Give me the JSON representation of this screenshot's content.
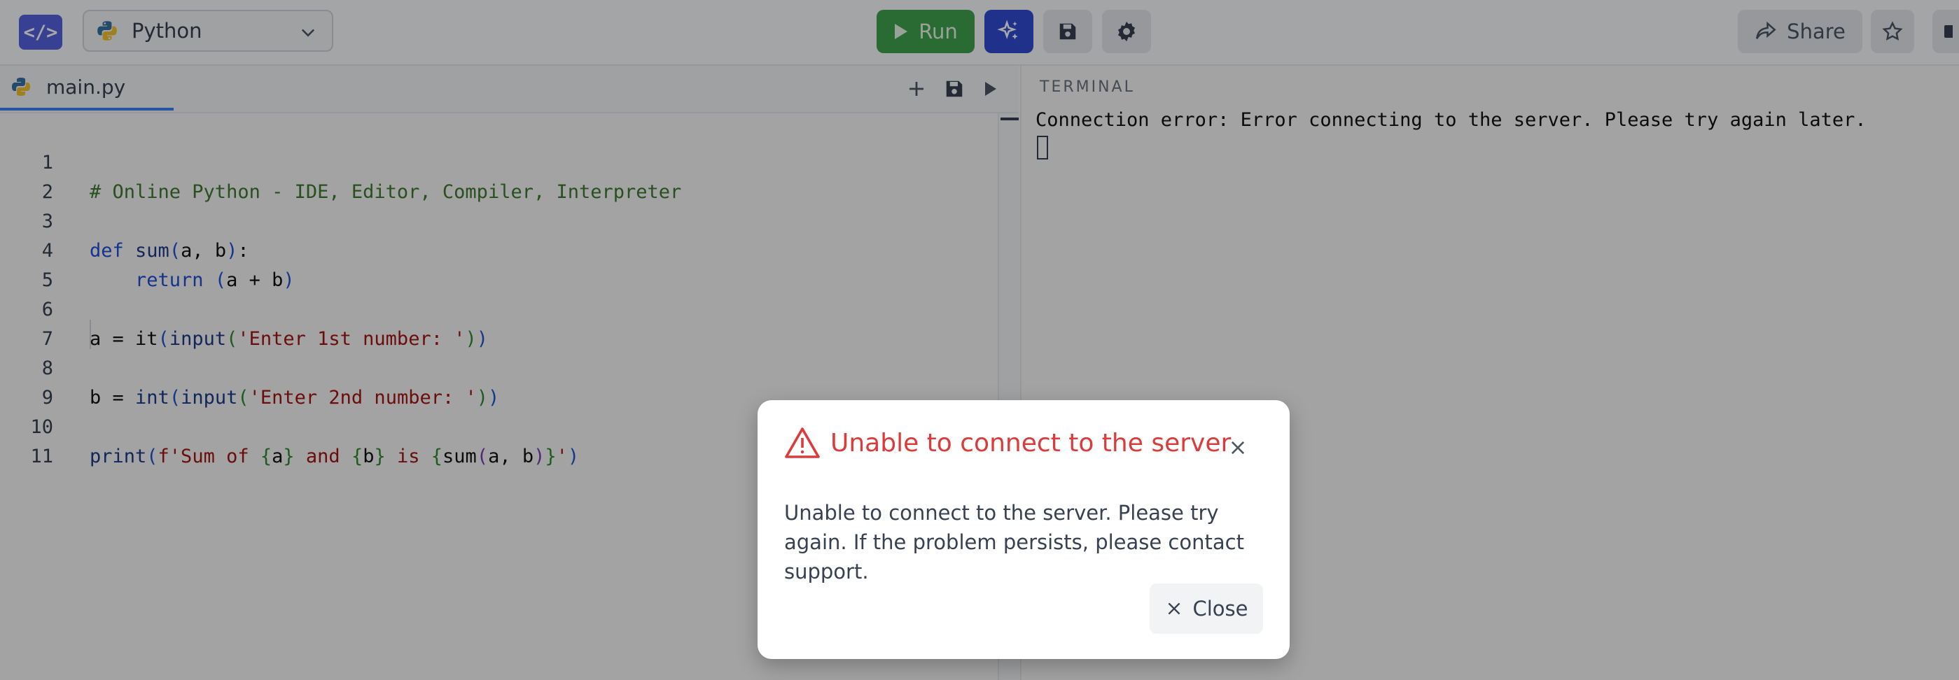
{
  "app": {
    "logo_text": "</>",
    "language": "Python",
    "accent_color": "#2f4bd3",
    "run_color": "#3fa34d"
  },
  "toolbar": {
    "run_label": "Run",
    "share_label": "Share",
    "icons": [
      "play-icon",
      "sparkles-icon",
      "save-icon",
      "gear-icon",
      "share-icon",
      "star-icon"
    ]
  },
  "editor": {
    "tab_name": "main.py",
    "tab_actions": [
      "add-file-icon",
      "save-file-icon",
      "run-file-icon"
    ],
    "line_numbers": [
      "1",
      "2",
      "3",
      "4",
      "5",
      "6",
      "7",
      "8",
      "9",
      "10",
      "11"
    ],
    "code": {
      "l1": "# Online Python - IDE, Editor, Compiler, Interpreter",
      "l3_kw": "def",
      "l3_fn": "sum",
      "l3_args": "a, b",
      "l4_kw": "return",
      "l4_expr": "a + b",
      "l6_var": "a = it",
      "l6_fn": "input",
      "l6_str": "'Enter 1st number: '",
      "l8_var": "b = ",
      "l8_fn1": "int",
      "l8_fn2": "input",
      "l8_str": "'Enter 2nd number: '",
      "l10_fn": "print",
      "l10_pre": "f'Sum of ",
      "l10_a": "a",
      "l10_and": " and ",
      "l10_b": "b",
      "l10_is": " is ",
      "l10_call": "sum",
      "l10_args": "a, b",
      "l10_end": "'"
    }
  },
  "terminal": {
    "title": "TERMINAL",
    "output": "Connection error: Error connecting to the server. Please try again later."
  },
  "modal": {
    "title": "Unable to connect to the server",
    "body": "Unable to connect to the server. Please try again. If the problem persists, please contact support.",
    "close_label": "Close",
    "error_color": "#dc3b3b"
  }
}
